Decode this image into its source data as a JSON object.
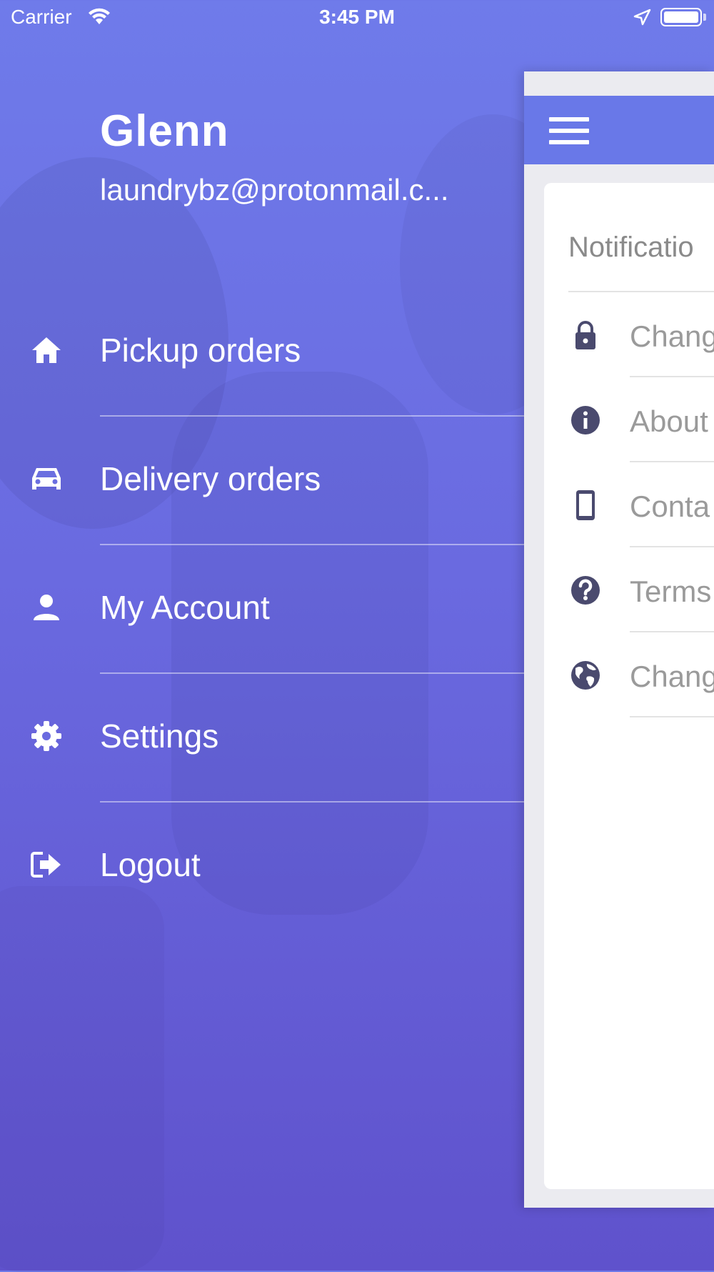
{
  "status_bar": {
    "carrier": "Carrier",
    "time": "3:45 PM"
  },
  "drawer": {
    "user_name": "Glenn",
    "user_email": "laundrybz@protonmail.c...",
    "menu": [
      {
        "label": "Pickup orders",
        "icon": "home-icon"
      },
      {
        "label": "Delivery orders",
        "icon": "car-icon"
      },
      {
        "label": "My Account",
        "icon": "person-icon"
      },
      {
        "label": "Settings",
        "icon": "gear-icon"
      },
      {
        "label": "Logout",
        "icon": "logout-icon"
      }
    ]
  },
  "settings_panel": {
    "section_title": "Notificatio",
    "rows": [
      {
        "label": "Chang",
        "icon": "lock-icon"
      },
      {
        "label": "About",
        "icon": "info-icon"
      },
      {
        "label": "Conta",
        "icon": "phone-icon"
      },
      {
        "label": "Terms",
        "icon": "help-icon"
      },
      {
        "label": "Chang",
        "icon": "globe-icon"
      }
    ]
  },
  "colors": {
    "drawer_gradient_top": "#6f7bea",
    "drawer_gradient_bottom": "#5f52cc",
    "header_blue": "#6978e8",
    "icon_dark": "#4a4a6e",
    "row_text": "#9a9a9a"
  }
}
